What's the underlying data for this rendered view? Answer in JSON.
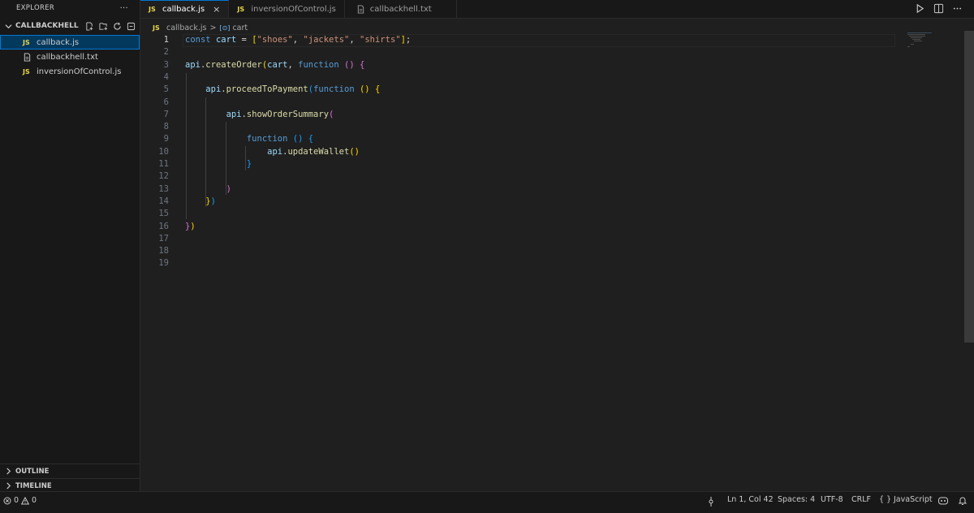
{
  "sidebar": {
    "title": "EXPLORER",
    "more": "···",
    "folder": "CALLBACKHELL",
    "files": [
      {
        "name": "callback.js",
        "type": "js",
        "badge": "JS"
      },
      {
        "name": "callbackhell.txt",
        "type": "txt"
      },
      {
        "name": "inversionOfControl.js",
        "type": "js",
        "badge": "JS"
      }
    ],
    "outline": "OUTLINE",
    "timeline": "TIMELINE"
  },
  "tabs": [
    {
      "label": "callback.js",
      "badge": "JS",
      "close": "×"
    },
    {
      "label": "inversionOfControl.js",
      "badge": "JS"
    },
    {
      "label": "callbackhell.txt"
    }
  ],
  "breadcrumb": {
    "badge": "JS",
    "file": "callback.js",
    "sep": ">",
    "symbol_icon": "[⊙]",
    "symbol": "cart"
  },
  "editor": {
    "line_numbers": [
      "1",
      "2",
      "3",
      "4",
      "5",
      "6",
      "7",
      "8",
      "9",
      "10",
      "11",
      "12",
      "13",
      "14",
      "15",
      "16",
      "17",
      "18",
      "19"
    ],
    "lines": [
      [
        [
          "kw",
          "const "
        ],
        [
          "var",
          "cart"
        ],
        [
          "op",
          " = "
        ],
        [
          "b1",
          "["
        ],
        [
          "str",
          "\"shoes\""
        ],
        [
          "op",
          ", "
        ],
        [
          "str",
          "\"jackets\""
        ],
        [
          "op",
          ", "
        ],
        [
          "str",
          "\"shirts\""
        ],
        [
          "b1",
          "]"
        ],
        [
          "op",
          ";"
        ]
      ],
      [],
      [
        [
          "var",
          "api"
        ],
        [
          "op",
          "."
        ],
        [
          "fn",
          "createOrder"
        ],
        [
          "b1",
          "("
        ],
        [
          "var",
          "cart"
        ],
        [
          "op",
          ", "
        ],
        [
          "kw",
          "function"
        ],
        [
          "op",
          " "
        ],
        [
          "b2",
          "()"
        ],
        [
          "op",
          " "
        ],
        [
          "b2",
          "{"
        ]
      ],
      [],
      [
        [
          "op",
          "    "
        ],
        [
          "var",
          "api"
        ],
        [
          "op",
          "."
        ],
        [
          "fn",
          "proceedToPayment"
        ],
        [
          "b3",
          "("
        ],
        [
          "kw",
          "function"
        ],
        [
          "op",
          " "
        ],
        [
          "b1",
          "()"
        ],
        [
          "op",
          " "
        ],
        [
          "b1",
          "{"
        ]
      ],
      [],
      [
        [
          "op",
          "        "
        ],
        [
          "var",
          "api"
        ],
        [
          "op",
          "."
        ],
        [
          "fn",
          "showOrderSummary"
        ],
        [
          "b2",
          "("
        ]
      ],
      [],
      [
        [
          "op",
          "            "
        ],
        [
          "kw",
          "function"
        ],
        [
          "op",
          " "
        ],
        [
          "b3",
          "()"
        ],
        [
          "op",
          " "
        ],
        [
          "b3",
          "{"
        ]
      ],
      [
        [
          "op",
          "                "
        ],
        [
          "var",
          "api"
        ],
        [
          "op",
          "."
        ],
        [
          "fn",
          "updateWallet"
        ],
        [
          "b1",
          "()"
        ]
      ],
      [
        [
          "op",
          "            "
        ],
        [
          "b3",
          "}"
        ]
      ],
      [],
      [
        [
          "op",
          "        "
        ],
        [
          "b2",
          ")"
        ]
      ],
      [
        [
          "op",
          "    "
        ],
        [
          "b1",
          "}"
        ],
        [
          "b3",
          ")"
        ]
      ],
      [],
      [
        [
          "b2",
          "}"
        ],
        [
          "b1",
          ")"
        ]
      ],
      [],
      [],
      []
    ]
  },
  "status": {
    "errors": "0",
    "warnings": "0",
    "position": "Ln 1, Col 42",
    "spaces": "Spaces: 4",
    "encoding": "UTF-8",
    "eol": "CRLF",
    "lang_icon": "{ }",
    "language": "JavaScript"
  },
  "colors": {
    "accent": "#0078d4",
    "js_badge": "#e9d54b",
    "background": "#1f1f1f",
    "sidebar": "#181818"
  }
}
